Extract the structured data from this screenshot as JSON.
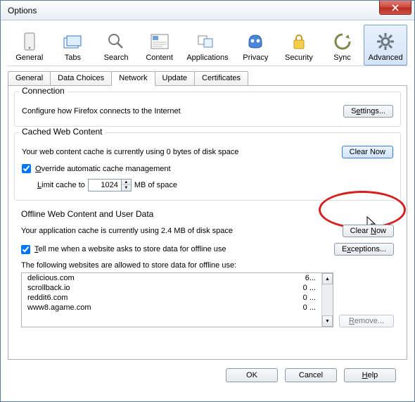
{
  "window": {
    "title": "Options"
  },
  "toolbar": {
    "items": [
      {
        "label": "General"
      },
      {
        "label": "Tabs"
      },
      {
        "label": "Search"
      },
      {
        "label": "Content"
      },
      {
        "label": "Applications"
      },
      {
        "label": "Privacy"
      },
      {
        "label": "Security"
      },
      {
        "label": "Sync"
      },
      {
        "label": "Advanced"
      }
    ]
  },
  "subtabs": {
    "items": [
      {
        "label": "General"
      },
      {
        "label": "Data Choices"
      },
      {
        "label": "Network"
      },
      {
        "label": "Update"
      },
      {
        "label": "Certificates"
      }
    ],
    "active": "Network"
  },
  "connection": {
    "legend": "Connection",
    "text": "Configure how Firefox connects to the Internet",
    "settings_btn": "Settings..."
  },
  "cached": {
    "legend": "Cached Web Content",
    "usage": "Your web content cache is currently using 0 bytes of disk space",
    "clear_btn": "Clear Now",
    "override_label": "Override automatic cache management",
    "override_checked": true,
    "limit_prefix": "Limit cache to",
    "limit_value": "1024",
    "limit_suffix": "MB of space"
  },
  "offline": {
    "legend": "Offline Web Content and User Data",
    "usage": "Your application cache is currently using 2.4 MB of disk space",
    "clear_btn": "Clear Now",
    "tellme_label": "Tell me when a website asks to store data for offline use",
    "tellme_checked": true,
    "exceptions_btn": "Exceptions...",
    "list_intro": "The following websites are allowed to store data for offline use:",
    "sites": [
      {
        "domain": "delicious.com",
        "size": "6..."
      },
      {
        "domain": "scrollback.io",
        "size": "0 ..."
      },
      {
        "domain": "reddit6.com",
        "size": "0 ..."
      },
      {
        "domain": "www8.agame.com",
        "size": "0 ..."
      }
    ],
    "remove_btn": "Remove..."
  },
  "dialog": {
    "ok": "OK",
    "cancel": "Cancel",
    "help": "Help"
  }
}
